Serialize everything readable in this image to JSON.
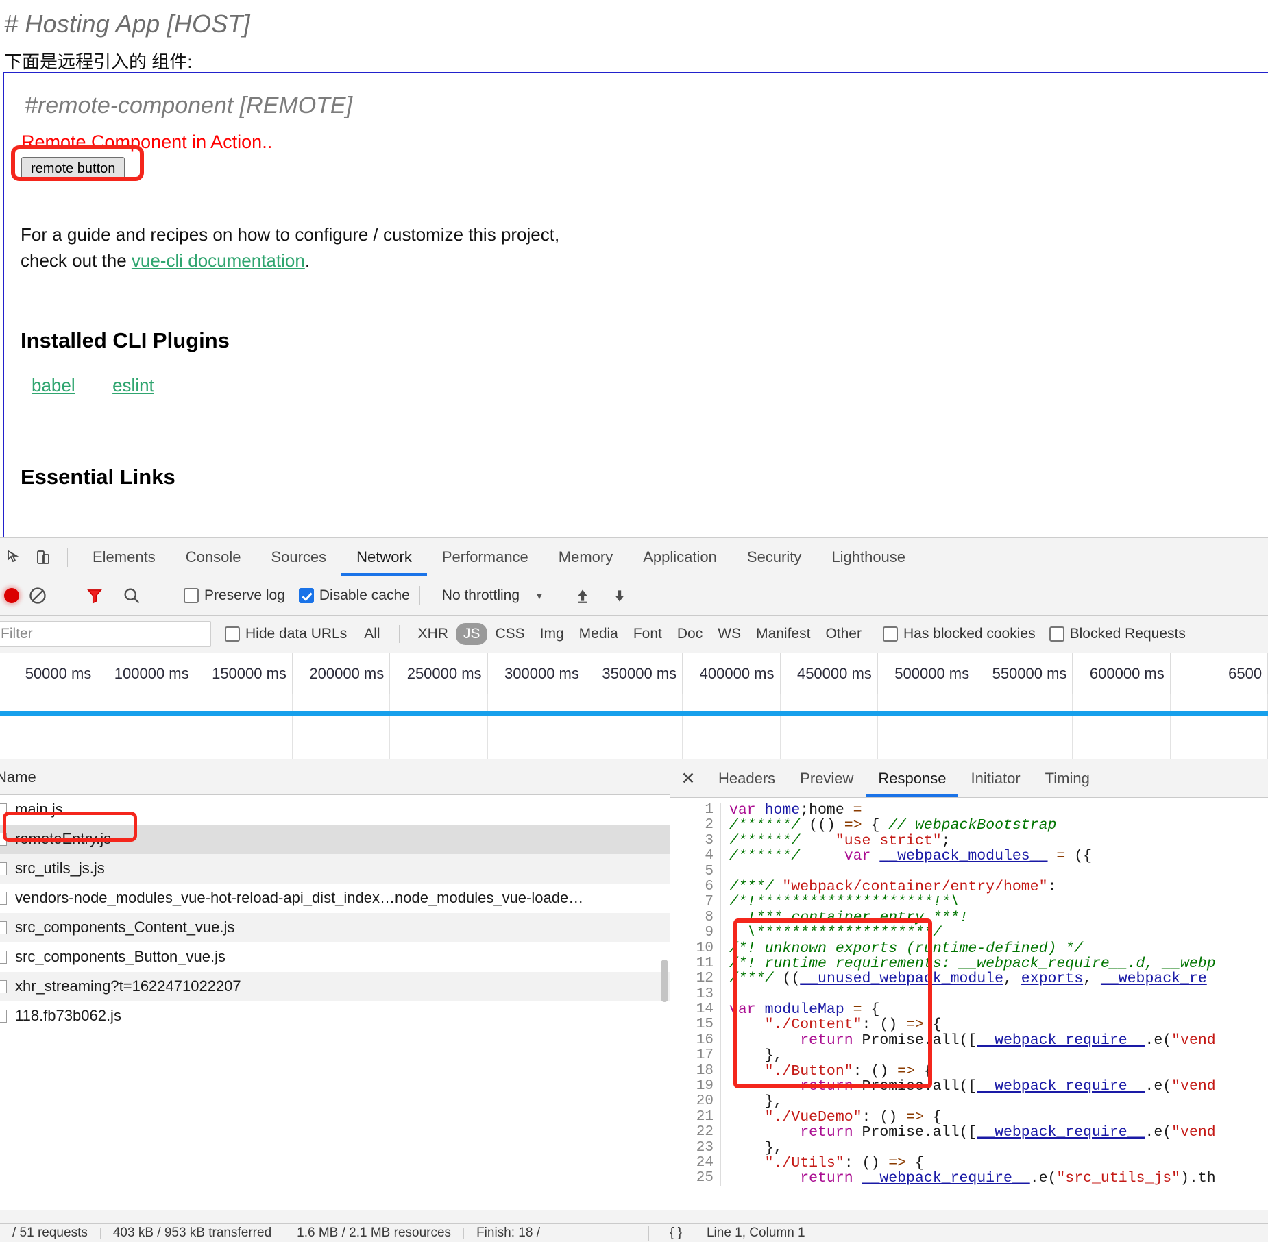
{
  "page": {
    "host_title": "# Hosting App [HOST]",
    "host_subtitle": "下面是远程引入的 组件:",
    "remote_title": "#remote-component [REMOTE]",
    "remote_action": "Remote Component in Action..",
    "remote_button": "remote button",
    "guide_line1": "For a guide and recipes on how to configure / customize this project,",
    "guide_line2_pre": "check out the ",
    "guide_link": "vue-cli documentation",
    "guide_line2_post": ".",
    "plugins_heading": "Installed CLI Plugins",
    "plugins": [
      "babel",
      "eslint"
    ],
    "essential_heading": "Essential Links"
  },
  "devtools": {
    "panel_tabs": [
      {
        "label": "Elements",
        "active": false
      },
      {
        "label": "Console",
        "active": false
      },
      {
        "label": "Sources",
        "active": false
      },
      {
        "label": "Network",
        "active": true
      },
      {
        "label": "Performance",
        "active": false
      },
      {
        "label": "Memory",
        "active": false
      },
      {
        "label": "Application",
        "active": false
      },
      {
        "label": "Security",
        "active": false
      },
      {
        "label": "Lighthouse",
        "active": false
      }
    ],
    "toolbar": {
      "record_icon": "record-dot-icon",
      "clear_icon": "clear-icon",
      "filter_icon": "filter-funnel-icon",
      "search_icon": "search-icon",
      "preserve_log_label": "Preserve log",
      "preserve_log_checked": false,
      "disable_cache_label": "Disable cache",
      "disable_cache_checked": true,
      "throttling_value": "No throttling",
      "import_icon": "upload-arrow-icon",
      "export_icon": "download-arrow-icon"
    },
    "filterbar": {
      "filter_placeholder": "Filter",
      "hide_data_urls_label": "Hide data URLs",
      "hide_data_urls_checked": false,
      "types": [
        "All",
        "XHR",
        "JS",
        "CSS",
        "Img",
        "Media",
        "Font",
        "Doc",
        "WS",
        "Manifest",
        "Other"
      ],
      "selected_type": "JS",
      "has_blocked_cookies_label": "Has blocked cookies",
      "has_blocked_cookies_checked": false,
      "blocked_requests_label": "Blocked Requests",
      "blocked_requests_checked": false
    },
    "timeline_ticks": [
      "50000 ms",
      "100000 ms",
      "150000 ms",
      "200000 ms",
      "250000 ms",
      "300000 ms",
      "350000 ms",
      "400000 ms",
      "450000 ms",
      "500000 ms",
      "550000 ms",
      "600000 ms",
      "6500"
    ],
    "requests": {
      "column_header": "Name",
      "rows": [
        {
          "name": "main.js",
          "selected": false
        },
        {
          "name": "remoteEntry.js",
          "selected": true
        },
        {
          "name": "src_utils_js.js",
          "selected": false
        },
        {
          "name": "vendors-node_modules_vue-hot-reload-api_dist_index…node_modules_vue-loade…",
          "selected": false
        },
        {
          "name": "src_components_Content_vue.js",
          "selected": false
        },
        {
          "name": "src_components_Button_vue.js",
          "selected": false
        },
        {
          "name": "xhr_streaming?t=1622471022207",
          "selected": false
        },
        {
          "name": "118.fb73b062.js",
          "selected": false
        }
      ]
    },
    "detail": {
      "close_icon": "close-icon",
      "tabs": [
        {
          "label": "Headers",
          "active": false
        },
        {
          "label": "Preview",
          "active": false
        },
        {
          "label": "Response",
          "active": true
        },
        {
          "label": "Initiator",
          "active": false
        },
        {
          "label": "Timing",
          "active": false
        }
      ],
      "code_lines": [
        {
          "n": 1,
          "tokens": [
            {
              "t": "var ",
              "c": "k"
            },
            {
              "t": "home",
              "c": "v"
            },
            {
              "t": ";",
              "c": "p"
            },
            {
              "t": "home ",
              "c": "p"
            },
            {
              "t": "=",
              "c": "o"
            }
          ]
        },
        {
          "n": 2,
          "tokens": [
            {
              "t": "/******/ ",
              "c": "c"
            },
            {
              "t": "(() ",
              "c": "p"
            },
            {
              "t": "=>",
              "c": "o"
            },
            {
              "t": " { ",
              "c": "p"
            },
            {
              "t": "// webpackBootstrap",
              "c": "c"
            }
          ]
        },
        {
          "n": 3,
          "tokens": [
            {
              "t": "/******/ ",
              "c": "c"
            },
            {
              "t": "   ",
              "c": "p"
            },
            {
              "t": "\"use strict\"",
              "c": "s"
            },
            {
              "t": ";",
              "c": "p"
            }
          ]
        },
        {
          "n": 4,
          "tokens": [
            {
              "t": "/******/ ",
              "c": "c"
            },
            {
              "t": "    ",
              "c": "p"
            },
            {
              "t": "var ",
              "c": "k"
            },
            {
              "t": "__webpack_modules__",
              "c": "u"
            },
            {
              "t": " = ",
              "c": "o"
            },
            {
              "t": "({",
              "c": "p"
            }
          ]
        },
        {
          "n": 5,
          "tokens": [
            {
              "t": "",
              "c": "p"
            }
          ]
        },
        {
          "n": 6,
          "tokens": [
            {
              "t": "/***/ ",
              "c": "c"
            },
            {
              "t": "\"webpack/container/entry/home\"",
              "c": "s"
            },
            {
              "t": ":",
              "c": "p"
            }
          ]
        },
        {
          "n": 7,
          "tokens": [
            {
              "t": "/*!********************!*\\",
              "c": "c"
            }
          ]
        },
        {
          "n": 8,
          "tokens": [
            {
              "t": "  !*** container entry ***!",
              "c": "c"
            }
          ]
        },
        {
          "n": 9,
          "tokens": [
            {
              "t": "  \\********************/",
              "c": "c"
            }
          ]
        },
        {
          "n": 10,
          "tokens": [
            {
              "t": "/*! unknown exports (runtime-defined) */",
              "c": "c"
            }
          ]
        },
        {
          "n": 11,
          "tokens": [
            {
              "t": "/*! runtime requirements: __webpack_require__.d, __webp",
              "c": "c"
            }
          ]
        },
        {
          "n": 12,
          "tokens": [
            {
              "t": "/***/ ",
              "c": "c"
            },
            {
              "t": "((",
              "c": "p"
            },
            {
              "t": "__unused_webpack_module",
              "c": "u"
            },
            {
              "t": ", ",
              "c": "p"
            },
            {
              "t": "exports",
              "c": "u"
            },
            {
              "t": ", ",
              "c": "p"
            },
            {
              "t": "__webpack_re",
              "c": "u"
            }
          ]
        },
        {
          "n": 13,
          "tokens": [
            {
              "t": "",
              "c": "p"
            }
          ]
        },
        {
          "n": 14,
          "tokens": [
            {
              "t": "var ",
              "c": "k"
            },
            {
              "t": "moduleMap",
              "c": "v"
            },
            {
              "t": " = ",
              "c": "o"
            },
            {
              "t": "{",
              "c": "p"
            }
          ]
        },
        {
          "n": 15,
          "tokens": [
            {
              "t": "    ",
              "c": "p"
            },
            {
              "t": "\"./Content\"",
              "c": "s"
            },
            {
              "t": ": () ",
              "c": "p"
            },
            {
              "t": "=>",
              "c": "o"
            },
            {
              "t": " {",
              "c": "p"
            }
          ]
        },
        {
          "n": 16,
          "tokens": [
            {
              "t": "        ",
              "c": "p"
            },
            {
              "t": "return ",
              "c": "k"
            },
            {
              "t": "Promise.all([",
              "c": "p"
            },
            {
              "t": "__webpack_require__",
              "c": "u"
            },
            {
              "t": ".e(",
              "c": "p"
            },
            {
              "t": "\"vend",
              "c": "s"
            }
          ]
        },
        {
          "n": 17,
          "tokens": [
            {
              "t": "    },",
              "c": "p"
            }
          ]
        },
        {
          "n": 18,
          "tokens": [
            {
              "t": "    ",
              "c": "p"
            },
            {
              "t": "\"./Button\"",
              "c": "s"
            },
            {
              "t": ": () ",
              "c": "p"
            },
            {
              "t": "=>",
              "c": "o"
            },
            {
              "t": " {",
              "c": "p"
            }
          ]
        },
        {
          "n": 19,
          "tokens": [
            {
              "t": "        ",
              "c": "p"
            },
            {
              "t": "return ",
              "c": "k"
            },
            {
              "t": "Promise.all([",
              "c": "p"
            },
            {
              "t": "__webpack_require__",
              "c": "u"
            },
            {
              "t": ".e(",
              "c": "p"
            },
            {
              "t": "\"vend",
              "c": "s"
            }
          ]
        },
        {
          "n": 20,
          "tokens": [
            {
              "t": "    },",
              "c": "p"
            }
          ]
        },
        {
          "n": 21,
          "tokens": [
            {
              "t": "    ",
              "c": "p"
            },
            {
              "t": "\"./VueDemo\"",
              "c": "s"
            },
            {
              "t": ": () ",
              "c": "p"
            },
            {
              "t": "=>",
              "c": "o"
            },
            {
              "t": " {",
              "c": "p"
            }
          ]
        },
        {
          "n": 22,
          "tokens": [
            {
              "t": "        ",
              "c": "p"
            },
            {
              "t": "return ",
              "c": "k"
            },
            {
              "t": "Promise.all([",
              "c": "p"
            },
            {
              "t": "__webpack_require__",
              "c": "u"
            },
            {
              "t": ".e(",
              "c": "p"
            },
            {
              "t": "\"vend",
              "c": "s"
            }
          ]
        },
        {
          "n": 23,
          "tokens": [
            {
              "t": "    },",
              "c": "p"
            }
          ]
        },
        {
          "n": 24,
          "tokens": [
            {
              "t": "    ",
              "c": "p"
            },
            {
              "t": "\"./Utils\"",
              "c": "s"
            },
            {
              "t": ": () ",
              "c": "p"
            },
            {
              "t": "=>",
              "c": "o"
            },
            {
              "t": " {",
              "c": "p"
            }
          ]
        },
        {
          "n": 25,
          "tokens": [
            {
              "t": "        ",
              "c": "p"
            },
            {
              "t": "return ",
              "c": "k"
            },
            {
              "t": "__webpack_require__",
              "c": "u"
            },
            {
              "t": ".e(",
              "c": "p"
            },
            {
              "t": "\"src_utils_js\"",
              "c": "s"
            },
            {
              "t": ").th",
              "c": "p"
            }
          ]
        }
      ]
    },
    "status": {
      "requests": "/ 51 requests",
      "transferred": "403 kB / 953 kB transferred",
      "resources": "1.6 MB / 2.1 MB resources",
      "finish": "Finish: 18 /",
      "format_icon": "{ }",
      "cursor_position": "Line 1, Column 1"
    }
  }
}
